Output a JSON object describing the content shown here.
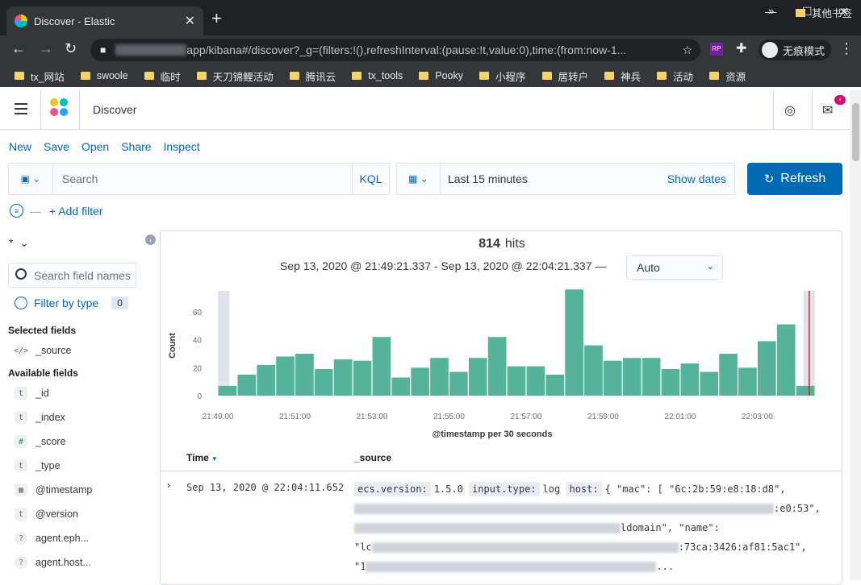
{
  "browser": {
    "tab_title": "Discover - Elastic",
    "url": "app/kibana#/discover?_g=(filters:!(),refreshInterval:(pause:!t,value:0),time:(from:now-1...",
    "incognito_label": "无痕模式",
    "bookmarks": [
      "tx_网站",
      "swoole",
      "临时",
      "天刀锦鲤活动",
      "腾讯云",
      "tx_tools",
      "Pooky",
      "小程序",
      "居转户",
      "神兵",
      "活动",
      "资源"
    ],
    "other_bookmarks": "其他书签",
    "more": "»"
  },
  "kibana": {
    "app_title": "Discover",
    "nav": [
      "New",
      "Save",
      "Open",
      "Share",
      "Inspect"
    ],
    "search_placeholder": "Search",
    "query_language": "KQL",
    "time_range": "Last 15 minutes",
    "show_dates": "Show dates",
    "refresh_label": "Refresh",
    "add_filter": "+ Add filter",
    "notification_count": "•"
  },
  "sidebar": {
    "index_pattern": "*",
    "search_placeholder": "Search field names",
    "filter_by_type": "Filter by type",
    "filter_count": "0",
    "selected_title": "Selected fields",
    "selected_fields": [
      {
        "name": "_source",
        "type": "source"
      }
    ],
    "available_title": "Available fields",
    "available_fields": [
      {
        "name": "_id",
        "type": "t"
      },
      {
        "name": "_index",
        "type": "t"
      },
      {
        "name": "_score",
        "type": "#"
      },
      {
        "name": "_type",
        "type": "t"
      },
      {
        "name": "@timestamp",
        "type": "date"
      },
      {
        "name": "@version",
        "type": "t"
      },
      {
        "name": "agent.eph...",
        "type": "?"
      },
      {
        "name": "agent.host...",
        "type": "?"
      }
    ]
  },
  "results": {
    "hits_count": "814",
    "hits_label": "hits",
    "time_range_text": "Sep 13, 2020 @ 21:49:21.337 - Sep 13, 2020 @ 22:04:21.337 —",
    "interval": "Auto",
    "col_time": "Time",
    "col_source": "_source",
    "row": {
      "time": "Sep 13, 2020 @ 22:04:11.652",
      "k1": "ecs.version:",
      "v1": "1.5.0",
      "k2": "input.type:",
      "v2": "log",
      "k3": "host:",
      "v3": "{ \"mac\": [ \"6c:2b:59:e8:18:d8\",",
      "l2_tail": ":e0:53\",",
      "l3_tail": "ldomain\", \"name\":",
      "l4_head": "\"lc",
      "l4_tail": ":73ca:3426:af81:5ac1\",",
      "l5_head": "\"1",
      "l5_tail": "..."
    }
  },
  "chart_data": {
    "type": "bar",
    "xlabel": "@timestamp per 30 seconds",
    "ylabel": "Count",
    "ylim": [
      0,
      75
    ],
    "yticks": [
      0,
      20,
      40,
      60
    ],
    "xticks": [
      "21:49:00",
      "21:51:00",
      "21:53:00",
      "21:55:00",
      "21:57:00",
      "21:59:00",
      "22:01:00",
      "22:03:00"
    ],
    "color": "#54b399",
    "values": [
      7,
      15,
      22,
      28,
      30,
      19,
      26,
      25,
      42,
      13,
      20,
      27,
      17,
      27,
      42,
      21,
      21,
      15,
      76,
      36,
      25,
      27,
      27,
      19,
      23,
      17,
      30,
      20,
      39,
      51,
      7
    ],
    "partial_bucket_shading": true,
    "now_marker": true
  }
}
